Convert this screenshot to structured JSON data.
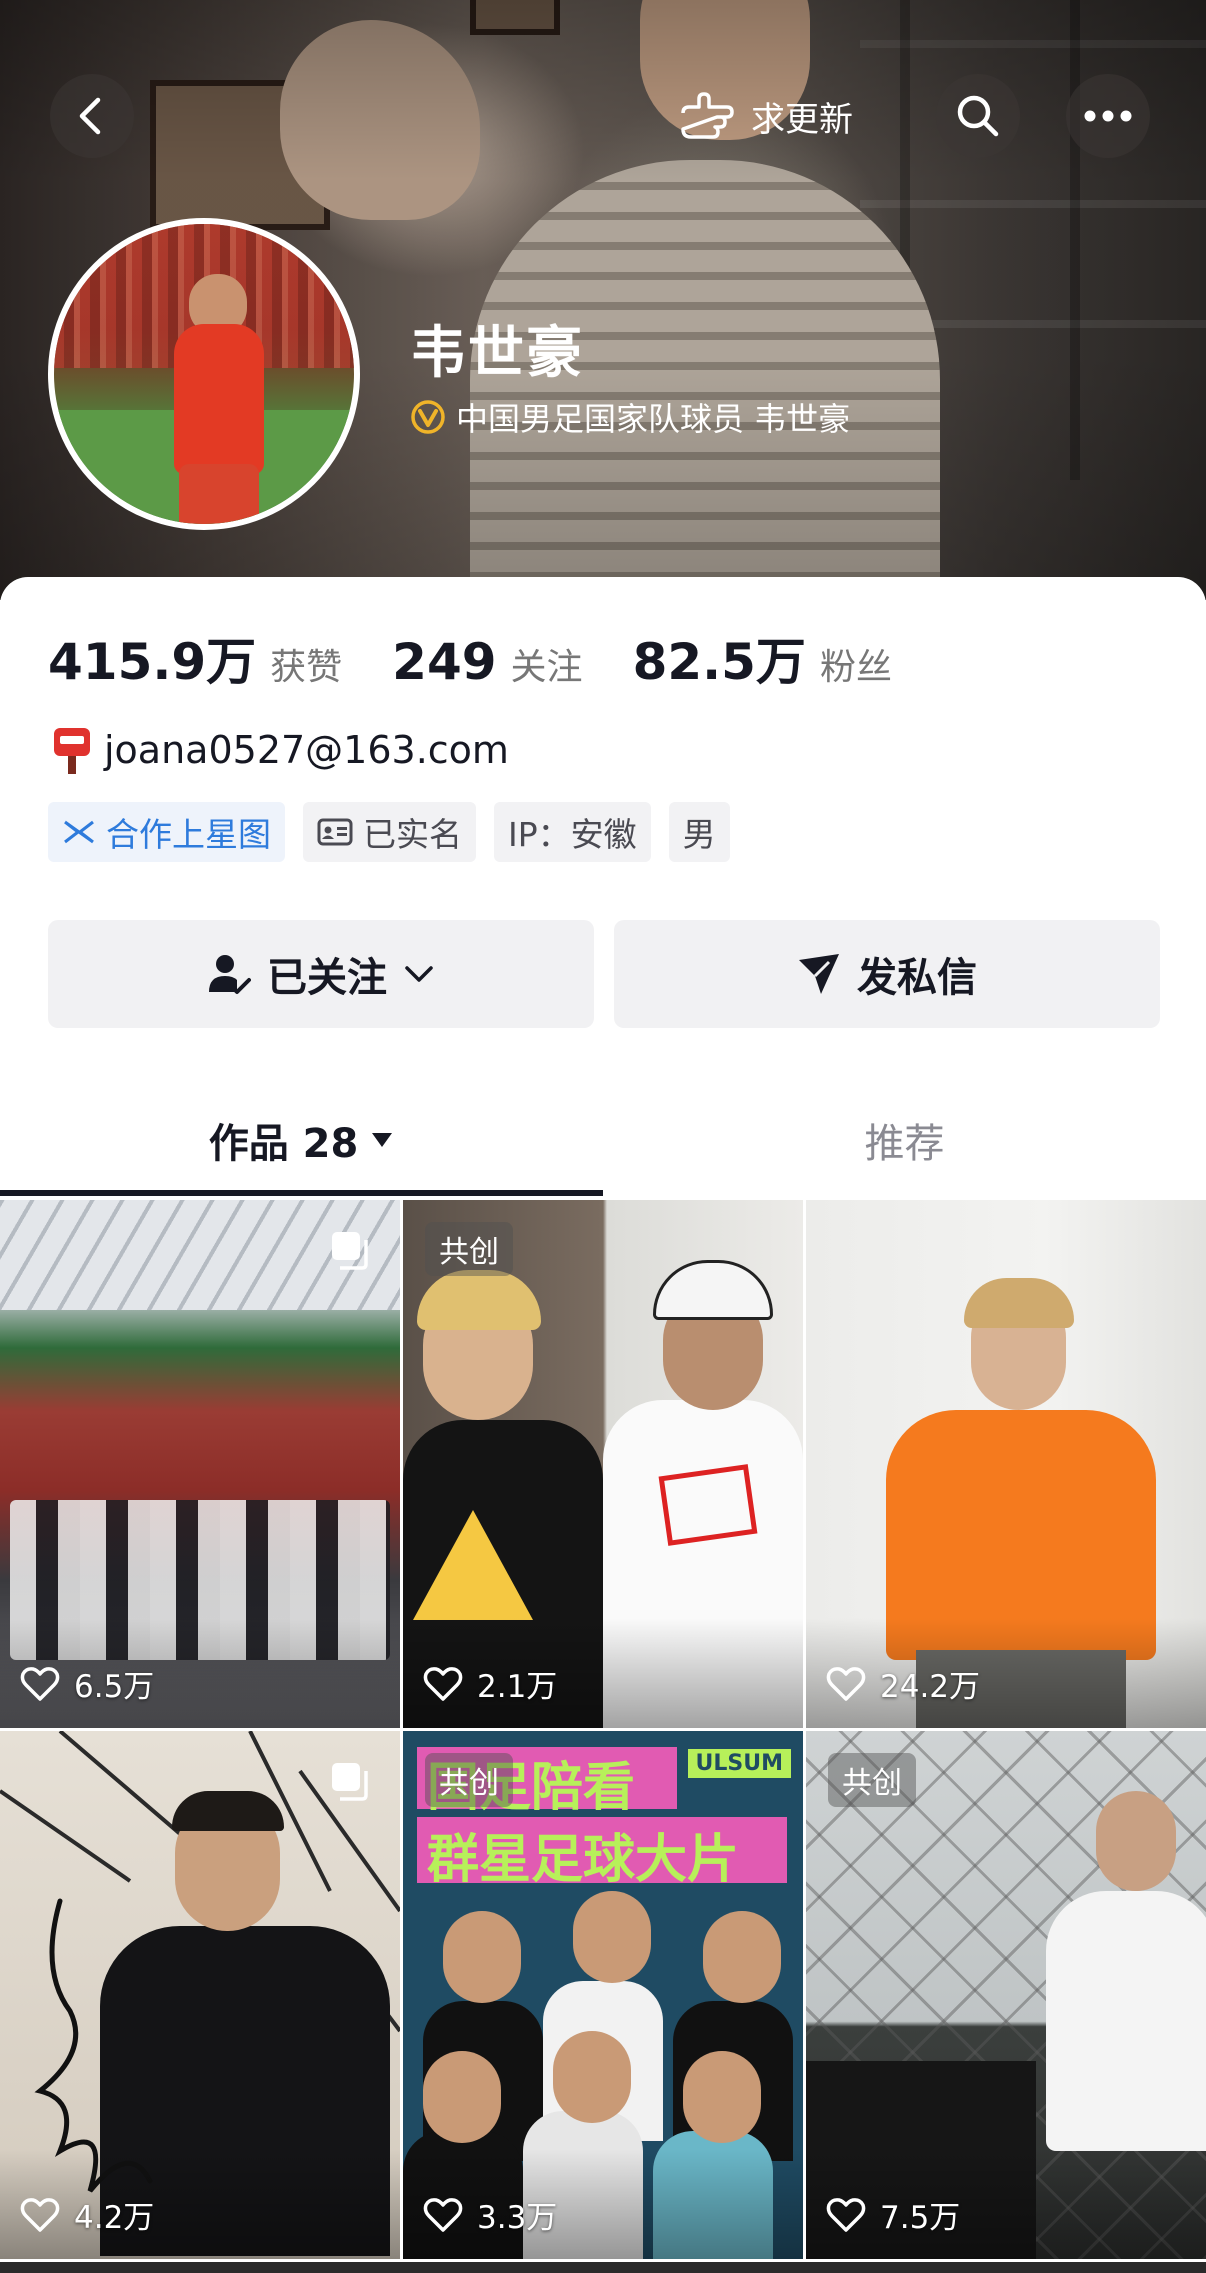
{
  "header": {
    "update_label": "求更新",
    "name": "韦世豪",
    "verify_text": "中国男足国家队球员 韦世豪",
    "verify_color": "#f0b429"
  },
  "stats": [
    {
      "num": "415.9万",
      "label": "获赞"
    },
    {
      "num": "249",
      "label": "关注"
    },
    {
      "num": "82.5万",
      "label": "粉丝"
    }
  ],
  "email": "joana0527@163.com",
  "tags": {
    "star": "合作上星图",
    "realname": "已实名",
    "ip": "IP：安徽",
    "gender": "男"
  },
  "buttons": {
    "follow": "已关注",
    "message": "发私信"
  },
  "tabs": {
    "works": "作品 28",
    "recommend": "推荐"
  },
  "grid": [
    {
      "likes": "6.5万",
      "badge": "",
      "multi": true
    },
    {
      "likes": "2.1万",
      "badge": "共创",
      "multi": false
    },
    {
      "likes": "24.2万",
      "badge": "",
      "multi": false
    },
    {
      "likes": "4.2万",
      "badge": "",
      "multi": true
    },
    {
      "likes": "3.3万",
      "badge": "共创",
      "multi": false
    },
    {
      "likes": "7.5万",
      "badge": "共创",
      "multi": false
    }
  ],
  "poster": {
    "line1": "国足陪看",
    "line2": "群星足球大片",
    "brand": "ULSUM"
  },
  "colors": {
    "accent_blue": "#2e7bdc",
    "text_main": "#161823"
  }
}
